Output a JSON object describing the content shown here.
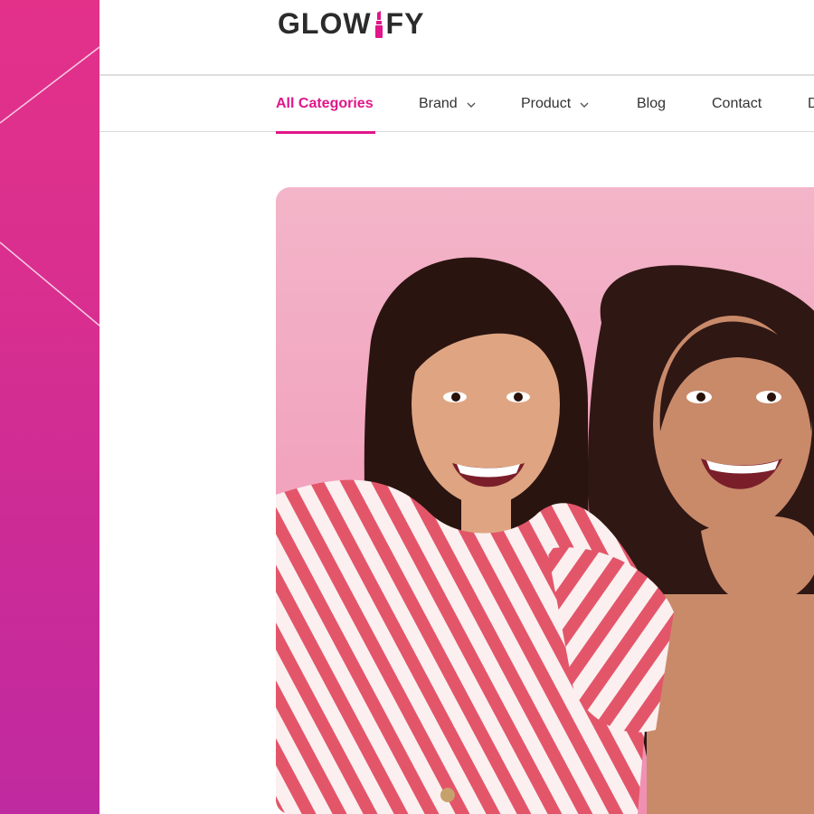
{
  "brand": {
    "name_pre": "GLOW",
    "name_post": "FY",
    "logo_icon": "lipstick-icon",
    "accent_color": "#e0168a",
    "logo_alt": "GLOWIFY"
  },
  "nav": {
    "items": [
      {
        "label": "All Categories",
        "active": true
      },
      {
        "label": "Brand",
        "dropdown": true
      },
      {
        "label": "Product",
        "dropdown": true
      },
      {
        "label": "Blog"
      },
      {
        "label": "Contact"
      },
      {
        "label": "D"
      }
    ],
    "dropdown_icon": "chevron-down-icon"
  },
  "hero": {
    "image": "photo-two-women-laughing-pink-background"
  },
  "colors": {
    "side_panel_top": "#e3318a",
    "side_panel_bottom": "#c02aa0",
    "hero_background": "#f4aac3"
  }
}
